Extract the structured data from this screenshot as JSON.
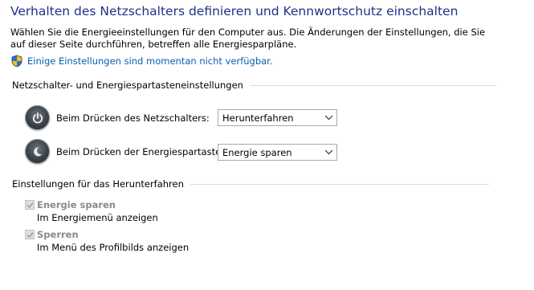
{
  "page": {
    "title": "Verhalten des Netzschalters definieren und Kennwortschutz einschalten",
    "description": "Wählen Sie die Energieeinstellungen für den Computer aus. Die Änderungen der Einstellungen, die Sie auf dieser Seite durchführen, betreffen alle Energiesparpläne.",
    "unavailable_link": "Einige Einstellungen sind momentan nicht verfügbar.",
    "unavailable_icon": "uac-shield-icon"
  },
  "power_section": {
    "heading": "Netzschalter- und Energiespartasteneinstellungen",
    "rows": [
      {
        "label": "Beim Drücken des Netzschalters:",
        "value": "Herunterfahren",
        "icon": "power-button-icon"
      },
      {
        "label": "Beim Drücken der Energiespartaste:",
        "value": "Energie sparen",
        "icon": "sleep-button-icon"
      }
    ]
  },
  "shutdown_section": {
    "heading": "Einstellungen für das Herunterfahren",
    "options": [
      {
        "label": "Energie sparen",
        "description": "Im Energiemenü anzeigen",
        "checked": true,
        "enabled": false
      },
      {
        "label": "Sperren",
        "description": "Im Menü des Profilbilds anzeigen",
        "checked": true,
        "enabled": false
      }
    ]
  },
  "colors": {
    "title": "#1e3287",
    "link": "#0a5fb4",
    "disabled_text": "#8a8a8a"
  }
}
